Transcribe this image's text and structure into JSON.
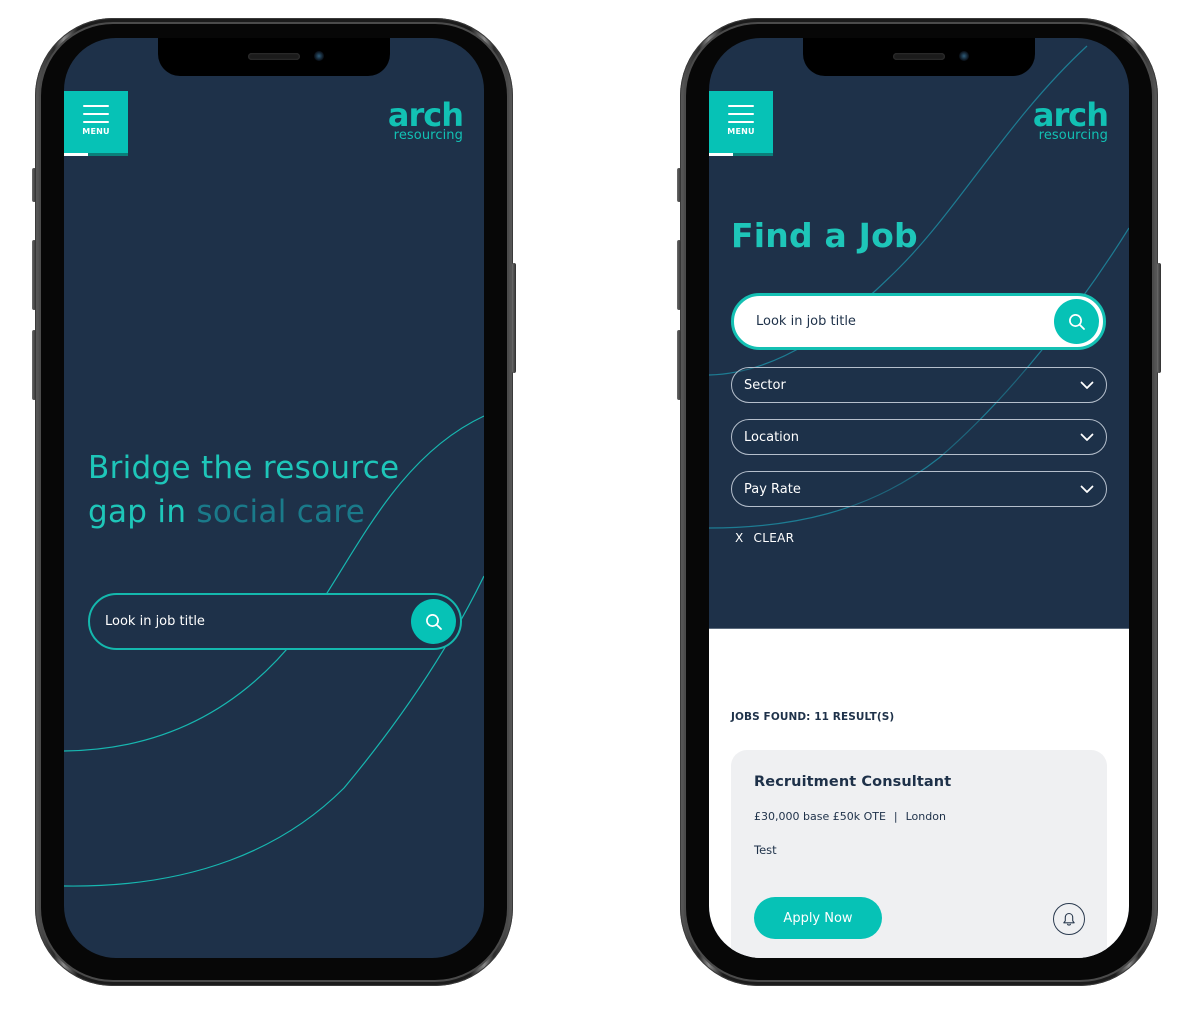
{
  "brand": {
    "logo_primary": "arch",
    "logo_secondary": "resourcing",
    "colors": {
      "accent": "#06c2b6",
      "navy": "#1e3149",
      "headline_muted": "#1a7a8a",
      "card_bg": "#eff0f2"
    }
  },
  "header": {
    "menu_label": "MENU",
    "menu_icon": "hamburger-icon"
  },
  "home_screen": {
    "headline_main": "Bridge the resource gap in ",
    "headline_highlight": "social care",
    "search": {
      "placeholder": "Look in job title",
      "button_icon": "search-icon"
    }
  },
  "find_job_screen": {
    "title": "Find a Job",
    "search": {
      "placeholder": "Look in job title",
      "button_icon": "search-icon"
    },
    "filters": [
      {
        "label": "Sector",
        "icon": "chevron-down-icon"
      },
      {
        "label": "Location",
        "icon": "chevron-down-icon"
      },
      {
        "label": "Pay Rate",
        "icon": "chevron-down-icon"
      }
    ],
    "clear": {
      "icon_text": "X",
      "label": "CLEAR"
    },
    "results": {
      "summary": "JOBS FOUND: 11 RESULT(S)",
      "jobs": [
        {
          "title": "Recruitment Consultant",
          "salary": "£30,000 base £50k OTE",
          "separator": "|",
          "location": "London",
          "description": "Test",
          "apply_label": "Apply Now",
          "alert_icon": "bell-icon"
        }
      ]
    }
  }
}
